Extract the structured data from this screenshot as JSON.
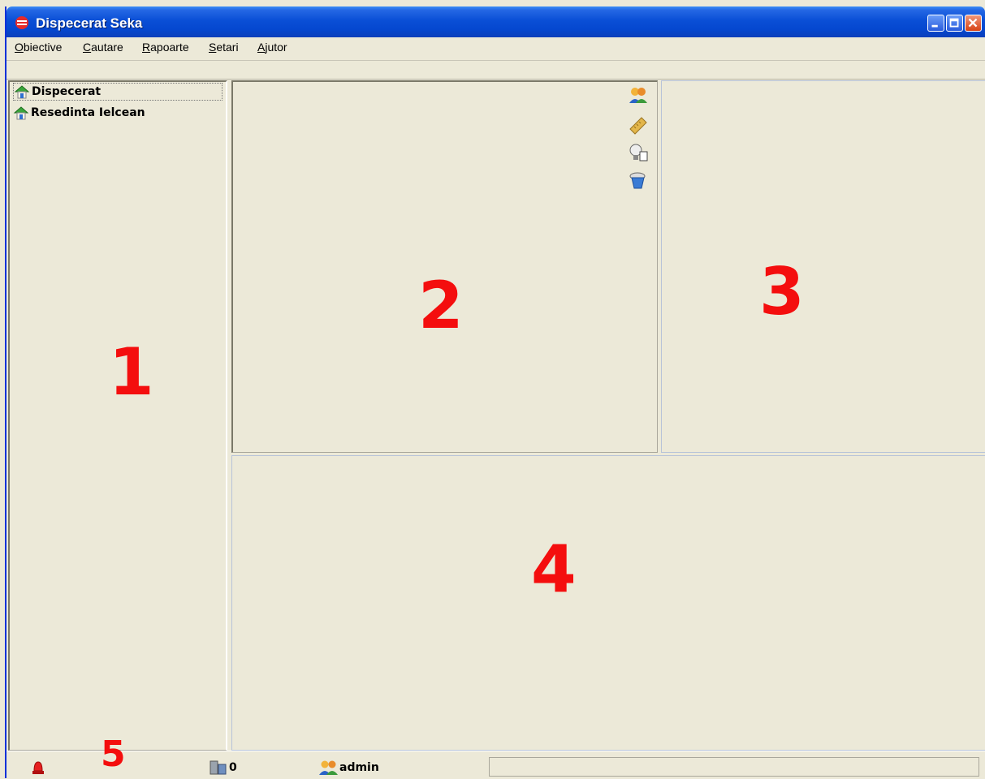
{
  "window": {
    "title": "Dispecerat Seka",
    "accent": "#0a4fd6"
  },
  "menu": [
    {
      "mnemonic": "O",
      "rest": "biective"
    },
    {
      "mnemonic": "C",
      "rest": "autare"
    },
    {
      "mnemonic": "R",
      "rest": "apoarte"
    },
    {
      "mnemonic": "S",
      "rest": "etari"
    },
    {
      "mnemonic": "A",
      "rest": "jutor"
    }
  ],
  "tree": {
    "items": [
      {
        "label": "Dispecerat",
        "icon": "house-icon"
      },
      {
        "label": "Resedinta Ielcean",
        "icon": "house-icon"
      }
    ]
  },
  "panel_numbers": {
    "one": "1",
    "two": "2",
    "three": "3",
    "four": "4",
    "five": "5"
  },
  "toolbar_icons": [
    "users-icon",
    "ruler-icon",
    "bulb-icon",
    "bucket-icon"
  ],
  "status": {
    "alarm_icon": "siren-icon",
    "count": "0",
    "user": "admin"
  },
  "colors": {
    "annotation_red": "#f40e0e"
  }
}
